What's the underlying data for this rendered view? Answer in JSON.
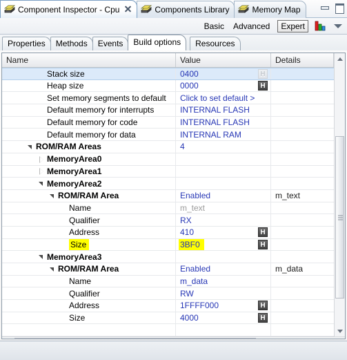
{
  "window": {
    "editor_tabs": [
      {
        "label": "Component Inspector - Cpu",
        "icon": "components-icon",
        "active": true,
        "closable": true
      },
      {
        "label": "Components Library",
        "icon": "components-icon",
        "active": false,
        "closable": false
      },
      {
        "label": "Memory Map",
        "icon": "components-icon",
        "active": false,
        "closable": false
      }
    ],
    "minimize_tooltip": "Minimize",
    "maximize_tooltip": "Maximize"
  },
  "modebar": {
    "basic": "Basic",
    "advanced": "Advanced",
    "expert": "Expert",
    "selected": "Expert",
    "chart_icon": "bar-chart-icon",
    "menu_icon": "view-menu-icon"
  },
  "section_tabs": [
    {
      "label": "Properties",
      "active": false
    },
    {
      "label": "Methods",
      "active": false
    },
    {
      "label": "Events",
      "active": false
    },
    {
      "label": "Build options",
      "active": true
    },
    {
      "label": "Resources",
      "active": false
    }
  ],
  "table": {
    "columns": [
      "Name",
      "Value",
      "Details"
    ],
    "rows": [
      {
        "name": "Stack size",
        "indent": 2,
        "value": "0400",
        "details": "",
        "selected": true,
        "hex_button": "H",
        "hex_dim": true,
        "bold": false,
        "twisty": "none"
      },
      {
        "name": "Heap size",
        "indent": 2,
        "value": "0000",
        "details": "",
        "selected": false,
        "hex_button": "H",
        "hex_dim": false,
        "bold": false,
        "twisty": "none"
      },
      {
        "name": "Set memory segments to default",
        "indent": 2,
        "value": "Click to set default >",
        "details": "",
        "selected": false,
        "hex_button": "",
        "bold": false,
        "twisty": "none"
      },
      {
        "name": "Default memory for interrupts",
        "indent": 2,
        "value": "INTERNAL FLASH",
        "details": "",
        "selected": false,
        "hex_button": "",
        "bold": false,
        "twisty": "none"
      },
      {
        "name": "Default memory for code",
        "indent": 2,
        "value": "INTERNAL FLASH",
        "details": "",
        "selected": false,
        "hex_button": "",
        "bold": false,
        "twisty": "none"
      },
      {
        "name": "Default memory for data",
        "indent": 2,
        "value": "INTERNAL RAM",
        "details": "",
        "selected": false,
        "hex_button": "",
        "bold": false,
        "twisty": "none"
      },
      {
        "name": "ROM/RAM Areas",
        "indent": 1,
        "value": "4",
        "details": "",
        "selected": false,
        "hex_button": "",
        "bold": true,
        "twisty": "open"
      },
      {
        "name": "MemoryArea0",
        "indent": 2,
        "value": "",
        "details": "",
        "selected": false,
        "hex_button": "",
        "bold": true,
        "twisty": "closed"
      },
      {
        "name": "MemoryArea1",
        "indent": 2,
        "value": "",
        "details": "",
        "selected": false,
        "hex_button": "",
        "bold": true,
        "twisty": "closed"
      },
      {
        "name": "MemoryArea2",
        "indent": 2,
        "value": "",
        "details": "",
        "selected": false,
        "hex_button": "",
        "bold": true,
        "twisty": "open"
      },
      {
        "name": "ROM/RAM Area",
        "indent": 3,
        "value": "Enabled",
        "details": "m_text",
        "selected": false,
        "hex_button": "",
        "bold": true,
        "twisty": "open"
      },
      {
        "name": "Name",
        "indent": 4,
        "value": "m_text",
        "value_style": "gray",
        "details": "",
        "selected": false,
        "hex_button": "",
        "bold": false,
        "twisty": "none"
      },
      {
        "name": "Qualifier",
        "indent": 4,
        "value": "RX",
        "details": "",
        "selected": false,
        "hex_button": "",
        "bold": false,
        "twisty": "none"
      },
      {
        "name": "Address",
        "indent": 4,
        "value": "410",
        "details": "",
        "selected": false,
        "hex_button": "H",
        "hex_dim": false,
        "bold": false,
        "twisty": "none"
      },
      {
        "name": "Size",
        "indent": 4,
        "value": "3BF0",
        "details": "",
        "selected": false,
        "hex_button": "H",
        "hex_dim": false,
        "bold": false,
        "twisty": "none",
        "highlight": true
      },
      {
        "name": "MemoryArea3",
        "indent": 2,
        "value": "",
        "details": "",
        "selected": false,
        "hex_button": "",
        "bold": true,
        "twisty": "open"
      },
      {
        "name": "ROM/RAM Area",
        "indent": 3,
        "value": "Enabled",
        "details": "m_data",
        "selected": false,
        "hex_button": "",
        "bold": true,
        "twisty": "open"
      },
      {
        "name": "Name",
        "indent": 4,
        "value": "m_data",
        "details": "",
        "selected": false,
        "hex_button": "",
        "bold": false,
        "twisty": "none"
      },
      {
        "name": "Qualifier",
        "indent": 4,
        "value": "RW",
        "details": "",
        "selected": false,
        "hex_button": "",
        "bold": false,
        "twisty": "none"
      },
      {
        "name": "Address",
        "indent": 4,
        "value": "1FFFF000",
        "details": "",
        "selected": false,
        "hex_button": "H",
        "hex_dim": false,
        "bold": false,
        "twisty": "none"
      },
      {
        "name": "Size",
        "indent": 4,
        "value": "4000",
        "details": "",
        "selected": false,
        "hex_button": "H",
        "hex_dim": false,
        "bold": false,
        "twisty": "none"
      },
      {
        "name": "",
        "indent": 0,
        "value": "",
        "details": "",
        "selected": false,
        "hex_button": "",
        "bold": false,
        "twisty": "none"
      }
    ]
  },
  "colors": {
    "value_text": "#2636b5",
    "highlight": "#ffff00",
    "selection": "#dceafa",
    "disabled_text": "#9b9b9b"
  }
}
